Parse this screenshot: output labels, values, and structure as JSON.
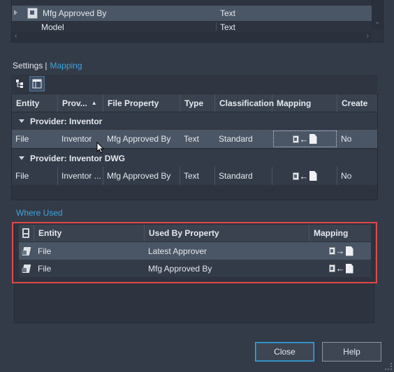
{
  "top_list": {
    "rows": [
      {
        "name": "Mfg Approved By",
        "type": "Text"
      },
      {
        "name": "Model",
        "type": "Text"
      }
    ]
  },
  "tabs": {
    "settings": "Settings",
    "separator": "|",
    "mapping": "Mapping"
  },
  "mapping_grid": {
    "columns": [
      "Entity",
      "Prov...",
      "File Property",
      "Type",
      "Classification",
      "Mapping",
      "Create"
    ],
    "groups": [
      {
        "label": "Provider: Inventor",
        "row": {
          "entity": "File",
          "provider": "Inventor",
          "file_property": "Mfg Approved By",
          "type": "Text",
          "classification": "Standard",
          "mapping": "file-to-property",
          "create": "No"
        }
      },
      {
        "label": "Provider: Inventor DWG",
        "row": {
          "entity": "File",
          "provider": "Inventor ...",
          "file_property": "Mfg Approved By",
          "type": "Text",
          "classification": "Standard",
          "mapping": "file-to-property",
          "create": "No"
        }
      }
    ]
  },
  "where_used": {
    "title": "Where Used",
    "columns": [
      "Entity",
      "Used By Property",
      "Mapping"
    ],
    "rows": [
      {
        "entity": "File",
        "used_by_property": "Latest Approver",
        "mapping": "property-to-file"
      },
      {
        "entity": "File",
        "used_by_property": "Mfg Approved By",
        "mapping": "file-to-property"
      }
    ]
  },
  "buttons": {
    "close": "Close",
    "help": "Help"
  },
  "colors": {
    "background": "#333b48",
    "accent": "#3ea4dc",
    "selection": "#4a5566",
    "highlight": "#e04848"
  }
}
